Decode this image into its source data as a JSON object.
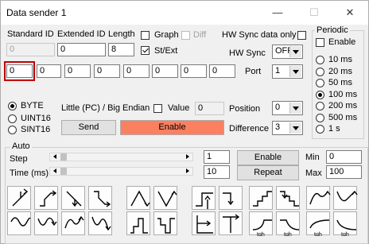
{
  "window": {
    "title": "Data sender 1",
    "minimize": "—",
    "maximize": "☐",
    "close": "✕"
  },
  "header": {
    "std_id_label": "Standard ID",
    "ext_id_label": "Extended ID",
    "length_label": "Length",
    "graph_label": "Graph",
    "diff_label": "Diff",
    "hw_sync_only_label": "HW Sync data only",
    "std_id_value": "0",
    "ext_id_value": "0",
    "length_value": "8",
    "st_ext_label": "St/Ext",
    "hw_sync_label": "HW Sync",
    "hw_sync_value": "OFF"
  },
  "bytes": [
    "0",
    "0",
    "0",
    "0",
    "0",
    "0",
    "0",
    "0"
  ],
  "port": {
    "label": "Port",
    "value": "1"
  },
  "format": {
    "byte": "BYTE",
    "uint16": "UINT16",
    "sint16": "SINT16",
    "endian_label": "Little (PC) / Big Endian",
    "value_label": "Value",
    "value": "0",
    "position_label": "Position",
    "position_value": "0",
    "difference_label": "Difference",
    "difference_value": "3",
    "send_label": "Send",
    "enable_label": "Enable"
  },
  "periodic": {
    "title": "Periodic",
    "enable_label": "Enable",
    "rates": [
      "10 ms",
      "20 ms",
      "50 ms",
      "100 ms",
      "200 ms",
      "500 ms",
      "1 s"
    ],
    "selected_rate": "100 ms"
  },
  "auto": {
    "title": "Auto",
    "step_label": "Step",
    "time_label": "Time (ms)",
    "step_value": "1",
    "time_value": "10",
    "enable_label": "Enable",
    "repeat_label": "Repeat",
    "min_label": "Min",
    "min_value": "0",
    "max_label": "Max",
    "max_value": "100",
    "tgh_label": "tgh"
  },
  "colors": {
    "enable_button": "#fb8060",
    "focus_outline": "#c00000"
  }
}
